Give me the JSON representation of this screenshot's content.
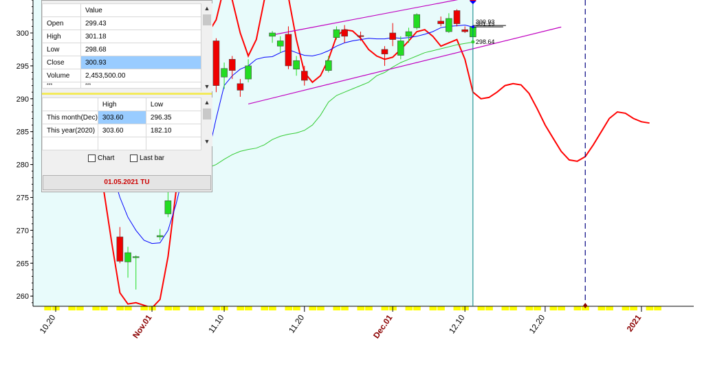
{
  "chart_data": {
    "type": "candlestick",
    "y_range": [
      258,
      305
    ],
    "y_ticks": [
      "300",
      "295",
      "290",
      "285",
      "280",
      "275",
      "270",
      "265",
      "260"
    ],
    "y_tick_values": [
      300,
      295,
      290,
      285,
      280,
      275,
      270,
      265,
      260
    ],
    "x_labels": [
      {
        "text": "10.20",
        "date": "2020-10-20",
        "color": "#000000",
        "bold": false
      },
      {
        "text": "Nov.01",
        "date": "2020-11-01",
        "color": "#8b0000",
        "bold": true
      },
      {
        "text": "11.10",
        "date": "2020-11-10",
        "color": "#000000",
        "bold": false
      },
      {
        "text": "11.20",
        "date": "2020-11-20",
        "color": "#000000",
        "bold": false
      },
      {
        "text": "Dec.01",
        "date": "2020-12-01",
        "color": "#8b0000",
        "bold": true
      },
      {
        "text": "12.10",
        "date": "2020-12-10",
        "color": "#000000",
        "bold": false
      },
      {
        "text": "12.20",
        "date": "2020-12-20",
        "color": "#000000",
        "bold": false
      },
      {
        "text": "2021",
        "date": "2021-01-01",
        "color": "#8b0000",
        "bold": true
      }
    ],
    "candles": [
      {
        "date": "2020-10-28",
        "open": 269.0,
        "high": 270.5,
        "low": 265.0,
        "close": 265.3
      },
      {
        "date": "2020-10-29",
        "open": 265.2,
        "high": 267.5,
        "low": 262.8,
        "close": 266.6
      },
      {
        "date": "2020-10-30",
        "open": 266.0,
        "high": 266.2,
        "low": 261.0,
        "close": 266.0
      },
      {
        "date": "2020-11-02",
        "open": 269.0,
        "high": 270.2,
        "low": 268.5,
        "close": 269.2
      },
      {
        "date": "2020-11-03",
        "open": 272.5,
        "high": 276.0,
        "low": 272.0,
        "close": 274.5
      },
      {
        "date": "2020-11-09",
        "open": 298.8,
        "high": 299.2,
        "low": 291.0,
        "close": 292.0
      },
      {
        "date": "2020-11-10",
        "open": 293.3,
        "high": 295.5,
        "low": 291.5,
        "close": 294.6
      },
      {
        "date": "2020-11-11",
        "open": 296.0,
        "high": 296.5,
        "low": 293.0,
        "close": 294.3
      },
      {
        "date": "2020-11-12",
        "open": 292.3,
        "high": 293.0,
        "low": 290.3,
        "close": 291.3
      },
      {
        "date": "2020-11-13",
        "open": 293.0,
        "high": 296.0,
        "low": 292.5,
        "close": 295.0
      },
      {
        "date": "2020-11-16",
        "open": 299.5,
        "high": 300.3,
        "low": 298.5,
        "close": 300.0
      },
      {
        "date": "2020-11-17",
        "open": 298.0,
        "high": 299.5,
        "low": 297.0,
        "close": 298.8
      },
      {
        "date": "2020-11-18",
        "open": 299.8,
        "high": 301.0,
        "low": 294.5,
        "close": 295.0
      },
      {
        "date": "2020-11-19",
        "open": 294.5,
        "high": 296.5,
        "low": 293.5,
        "close": 295.8
      },
      {
        "date": "2020-11-20",
        "open": 294.2,
        "high": 295.0,
        "low": 292.0,
        "close": 292.8
      },
      {
        "date": "2020-11-23",
        "open": 294.3,
        "high": 296.5,
        "low": 294.0,
        "close": 295.8
      },
      {
        "date": "2020-11-24",
        "open": 299.3,
        "high": 301.0,
        "low": 299.0,
        "close": 300.5
      },
      {
        "date": "2020-11-25",
        "open": 300.5,
        "high": 301.2,
        "low": 298.5,
        "close": 299.5
      },
      {
        "date": "2020-11-27",
        "open": 299.6,
        "high": 300.2,
        "low": 298.8,
        "close": 299.5
      },
      {
        "date": "2020-11-30",
        "open": 297.5,
        "high": 298.0,
        "low": 295.0,
        "close": 296.8
      },
      {
        "date": "2020-12-01",
        "open": 300.0,
        "high": 301.5,
        "low": 298.0,
        "close": 299.0
      },
      {
        "date": "2020-12-02",
        "open": 296.6,
        "high": 299.5,
        "low": 296.0,
        "close": 298.8
      },
      {
        "date": "2020-12-03",
        "open": 299.5,
        "high": 300.8,
        "low": 298.5,
        "close": 300.2
      },
      {
        "date": "2020-12-04",
        "open": 300.8,
        "high": 303.0,
        "low": 300.5,
        "close": 302.8
      },
      {
        "date": "2020-12-07",
        "open": 301.8,
        "high": 302.5,
        "low": 301.0,
        "close": 301.4
      },
      {
        "date": "2020-12-08",
        "open": 300.2,
        "high": 303.0,
        "low": 300.0,
        "close": 302.2
      },
      {
        "date": "2020-12-09",
        "open": 303.4,
        "high": 303.6,
        "low": 301.0,
        "close": 301.4
      },
      {
        "date": "2020-12-10",
        "open": 300.5,
        "high": 301.0,
        "low": 300.0,
        "close": 300.2
      },
      {
        "date": "2020-12-11",
        "open": 299.4,
        "high": 301.2,
        "low": 298.7,
        "close": 300.9
      }
    ],
    "lines": [
      {
        "color": "#ff0000",
        "points": [
          [
            "2020-10-26",
            276
          ],
          [
            "2020-10-27",
            268
          ],
          [
            "2020-10-28",
            260.5
          ],
          [
            "2020-10-29",
            258.8
          ],
          [
            "2020-10-30",
            259
          ],
          [
            "2020-10-31",
            258.6
          ],
          [
            "2020-11-01",
            258.2
          ],
          [
            "2020-11-02",
            259.5
          ],
          [
            "2020-11-03",
            266
          ],
          [
            "2020-11-04",
            276
          ],
          [
            "2020-11-05",
            283
          ],
          [
            "2020-11-06",
            285.5
          ],
          [
            "2020-11-07",
            286
          ],
          [
            "2020-11-08",
            300
          ],
          [
            "2020-11-09",
            302
          ],
          [
            "2020-11-10",
            307
          ],
          [
            "2020-11-11",
            305
          ],
          [
            "2020-11-12",
            300
          ],
          [
            "2020-11-13",
            296.5
          ],
          [
            "2020-11-14",
            299
          ],
          [
            "2020-11-15",
            305
          ],
          [
            "2020-11-16",
            308
          ],
          [
            "2020-11-17",
            309
          ],
          [
            "2020-11-18",
            305.5
          ],
          [
            "2020-11-19",
            299
          ],
          [
            "2020-11-20",
            294
          ],
          [
            "2020-11-21",
            292.5
          ],
          [
            "2020-11-22",
            293.5
          ],
          [
            "2020-11-23",
            296
          ],
          [
            "2020-11-24",
            299.5
          ],
          [
            "2020-11-25",
            300.5
          ],
          [
            "2020-11-26",
            300.3
          ],
          [
            "2020-11-27",
            299.2
          ],
          [
            "2020-11-28",
            297.5
          ],
          [
            "2020-11-29",
            296.5
          ],
          [
            "2020-11-30",
            296
          ],
          [
            "2020-12-01",
            296.3
          ],
          [
            "2020-12-02",
            297.5
          ],
          [
            "2020-12-03",
            298.8
          ],
          [
            "2020-12-04",
            300.2
          ],
          [
            "2020-12-05",
            300.5
          ],
          [
            "2020-12-06",
            299.5
          ],
          [
            "2020-12-07",
            298
          ],
          [
            "2020-12-08",
            298.5
          ],
          [
            "2020-12-09",
            299
          ],
          [
            "2020-12-10",
            296
          ],
          [
            "2020-12-11",
            291
          ],
          [
            "2020-12-12",
            290
          ],
          [
            "2020-12-13",
            290.2
          ],
          [
            "2020-12-14",
            291
          ],
          [
            "2020-12-15",
            292
          ],
          [
            "2020-12-16",
            292.3
          ],
          [
            "2020-12-17",
            292.1
          ],
          [
            "2020-12-18",
            290.8
          ],
          [
            "2020-12-19",
            288.5
          ],
          [
            "2020-12-20",
            286
          ],
          [
            "2020-12-21",
            284
          ],
          [
            "2020-12-22",
            282
          ],
          [
            "2020-12-23",
            280.7
          ],
          [
            "2020-12-24",
            280.5
          ],
          [
            "2020-12-25",
            281.2
          ],
          [
            "2020-12-26",
            283
          ],
          [
            "2020-12-27",
            285
          ],
          [
            "2020-12-28",
            287
          ],
          [
            "2020-12-29",
            288
          ],
          [
            "2020-12-30",
            287.8
          ],
          [
            "2020-12-31",
            287
          ],
          [
            "2021-01-01",
            286.5
          ],
          [
            "2021-01-02",
            286.3
          ]
        ]
      },
      {
        "color": "#0000ff",
        "points": [
          [
            "2020-10-26",
            283
          ],
          [
            "2020-10-27",
            279
          ],
          [
            "2020-10-28",
            275
          ],
          [
            "2020-10-29",
            272
          ],
          [
            "2020-10-30",
            270
          ],
          [
            "2020-10-31",
            268.5
          ],
          [
            "2020-11-01",
            268
          ],
          [
            "2020-11-02",
            268.1
          ],
          [
            "2020-11-03",
            270
          ],
          [
            "2020-11-04",
            274
          ],
          [
            "2020-11-05",
            279
          ],
          [
            "2020-11-06",
            279.5
          ],
          [
            "2020-11-07",
            279
          ],
          [
            "2020-11-08",
            281.5
          ],
          [
            "2020-11-09",
            287
          ],
          [
            "2020-11-10",
            292
          ],
          [
            "2020-11-11",
            293.5
          ],
          [
            "2020-11-12",
            294.5
          ],
          [
            "2020-11-13",
            295
          ],
          [
            "2020-11-14",
            296
          ],
          [
            "2020-11-15",
            296.3
          ],
          [
            "2020-11-16",
            296.4
          ],
          [
            "2020-11-17",
            297
          ],
          [
            "2020-11-18",
            297.5
          ],
          [
            "2020-11-19",
            297
          ],
          [
            "2020-11-20",
            296.6
          ],
          [
            "2020-11-21",
            296.5
          ],
          [
            "2020-11-22",
            296.8
          ],
          [
            "2020-11-23",
            297.3
          ],
          [
            "2020-11-24",
            298
          ],
          [
            "2020-11-25",
            298.5
          ],
          [
            "2020-11-26",
            298.8
          ],
          [
            "2020-11-27",
            299
          ],
          [
            "2020-11-28",
            299.2
          ],
          [
            "2020-11-29",
            299.1
          ],
          [
            "2020-11-30",
            299.1
          ],
          [
            "2020-12-01",
            299.3
          ],
          [
            "2020-12-02",
            299.2
          ],
          [
            "2020-12-03",
            299.3
          ],
          [
            "2020-12-04",
            299.5
          ],
          [
            "2020-12-05",
            299.8
          ],
          [
            "2020-12-06",
            300.2
          ],
          [
            "2020-12-07",
            300.8
          ],
          [
            "2020-12-08",
            301
          ],
          [
            "2020-12-09",
            301.1
          ],
          [
            "2020-12-10",
            301.2
          ],
          [
            "2020-12-11",
            300.9
          ]
        ]
      },
      {
        "color": "#33cc33",
        "points": [
          [
            "2020-10-26",
            279.2
          ],
          [
            "2020-10-28",
            279.3
          ],
          [
            "2020-10-30",
            279.5
          ],
          [
            "2020-11-01",
            279.6
          ],
          [
            "2020-11-03",
            279.3
          ],
          [
            "2020-11-05",
            278.8
          ],
          [
            "2020-11-06",
            279.1
          ],
          [
            "2020-11-07",
            279.3
          ],
          [
            "2020-11-08",
            279.5
          ],
          [
            "2020-11-09",
            280
          ],
          [
            "2020-11-10",
            280.8
          ],
          [
            "2020-11-11",
            281.5
          ],
          [
            "2020-11-12",
            282
          ],
          [
            "2020-11-13",
            282.3
          ],
          [
            "2020-11-14",
            282.5
          ],
          [
            "2020-11-15",
            283
          ],
          [
            "2020-11-16",
            283.8
          ],
          [
            "2020-11-17",
            284.3
          ],
          [
            "2020-11-18",
            284.6
          ],
          [
            "2020-11-19",
            284.8
          ],
          [
            "2020-11-20",
            285.2
          ],
          [
            "2020-11-21",
            286
          ],
          [
            "2020-11-22",
            287.5
          ],
          [
            "2020-11-23",
            289.5
          ],
          [
            "2020-11-24",
            290.5
          ],
          [
            "2020-11-25",
            291
          ],
          [
            "2020-11-26",
            291.5
          ],
          [
            "2020-11-27",
            292
          ],
          [
            "2020-11-28",
            292.5
          ],
          [
            "2020-11-29",
            293.5
          ],
          [
            "2020-11-30",
            294
          ],
          [
            "2020-12-01",
            294.8
          ],
          [
            "2020-12-02",
            295.5
          ],
          [
            "2020-12-03",
            296
          ],
          [
            "2020-12-04",
            296.5
          ],
          [
            "2020-12-05",
            297
          ],
          [
            "2020-12-06",
            297.3
          ],
          [
            "2020-12-07",
            297.6
          ],
          [
            "2020-12-08",
            297.9
          ],
          [
            "2020-12-09",
            298.2
          ],
          [
            "2020-12-10",
            298.4
          ],
          [
            "2020-12-11",
            298.6
          ]
        ]
      }
    ],
    "channel_lines": [
      {
        "color": "#c000c0",
        "from": [
          "2020-11-16",
          299.7
        ],
        "to": [
          "2020-12-11",
          305.5
        ]
      },
      {
        "color": "#c000c0",
        "from": [
          "2020-11-13",
          289.2
        ],
        "to": [
          "2020-12-22",
          300.9
        ]
      }
    ],
    "price_labels": [
      {
        "text": "300.93",
        "value": 300.93
      },
      {
        "text": "301.13",
        "value": 301.13
      },
      {
        "text": "298.64",
        "value": 298.64
      }
    ],
    "cursor_date": "2020-12-11",
    "future_cursor_date": "2020-12-25",
    "colors": {
      "up": "#22dd22",
      "down": "#ee0000",
      "plot_bg": "#e8fbfb",
      "axis_highlight": "#ffff00"
    }
  },
  "data_window": {
    "header": [
      "",
      "Value"
    ],
    "rows": [
      {
        "label": "Open",
        "value": "299.43"
      },
      {
        "label": "High",
        "value": "301.18"
      },
      {
        "label": "Low",
        "value": "298.68"
      },
      {
        "label": "Close",
        "value": "300.93"
      },
      {
        "label": "Volume",
        "value": "2,453,500.00"
      },
      {
        "label": "***",
        "value": "***"
      }
    ]
  },
  "range_window": {
    "header": [
      "",
      "High",
      "Low"
    ],
    "rows": [
      {
        "label": "This month(Dec)",
        "high": "303.60",
        "low": "296.35"
      },
      {
        "label": "This year(2020)",
        "high": "303.60",
        "low": "182.10"
      }
    ]
  },
  "options": {
    "chart": "Chart",
    "last_bar": "Last bar"
  },
  "date_display": "01.05.2021 TU"
}
